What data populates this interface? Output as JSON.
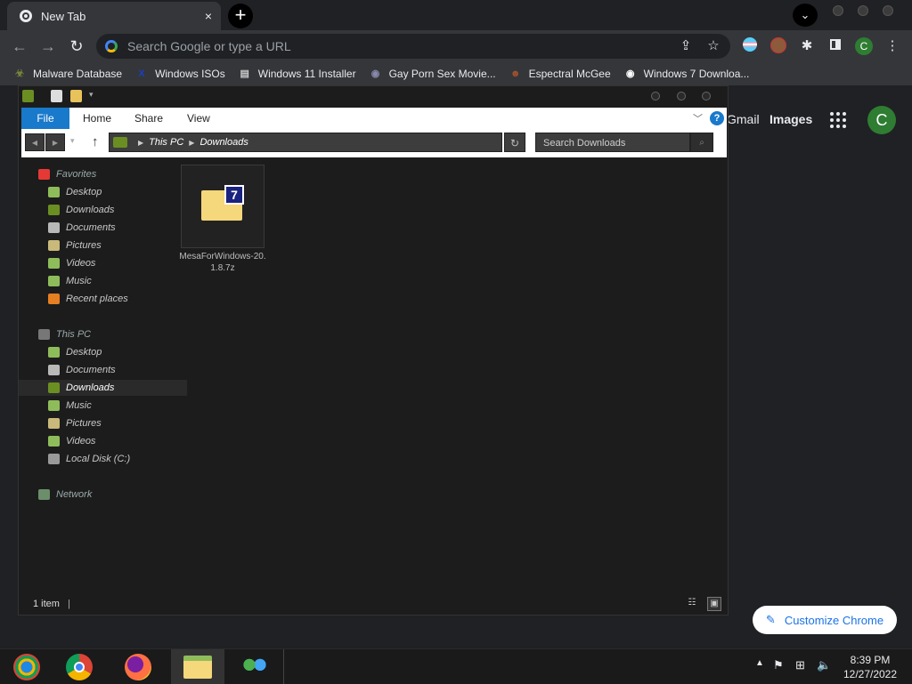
{
  "browser": {
    "tab": {
      "label": "New Tab",
      "close_glyph": "×"
    },
    "new_tab_glyph": "+",
    "tab_search_glyph": "⌄",
    "omnibox": {
      "placeholder": "Search Google or type a URL"
    },
    "profile_initial": "C",
    "bookmarks": [
      {
        "label": "Malware Database",
        "icon": "biohazard-icon",
        "color": "#7b8a3a"
      },
      {
        "label": "Windows ISOs",
        "icon": "x-icon",
        "color": "#1a3fbf"
      },
      {
        "label": "Windows 11 Installer",
        "icon": "page-icon",
        "color": "#cccccc"
      },
      {
        "label": "Gay Porn Sex Movie...",
        "icon": "globe-icon",
        "color": "#8888aa"
      },
      {
        "label": "Espectral McGee",
        "icon": "avatar-icon",
        "color": "#a0522d"
      },
      {
        "label": "Windows 7 Downloa...",
        "icon": "globe-icon",
        "color": "#ffffff"
      }
    ]
  },
  "ntp": {
    "gmail": "Gmail",
    "images": "Images",
    "avatar": "C",
    "customize": "Customize Chrome"
  },
  "explorer": {
    "ribbon": {
      "file": "File",
      "tabs": [
        "Home",
        "Share",
        "View"
      ],
      "help": "?"
    },
    "address": {
      "crumbs": [
        "This PC",
        "Downloads"
      ]
    },
    "search": {
      "placeholder": "Search Downloads"
    },
    "nav": {
      "favorites_label": "Favorites",
      "favorites": [
        {
          "label": "Desktop",
          "color": "#8fbc5a"
        },
        {
          "label": "Downloads",
          "color": "#6b8e23"
        },
        {
          "label": "Documents",
          "color": "#b8b8b8"
        },
        {
          "label": "Pictures",
          "color": "#c9b97a"
        },
        {
          "label": "Videos",
          "color": "#8fbc5a"
        },
        {
          "label": "Music",
          "color": "#8fbc5a"
        },
        {
          "label": "Recent places",
          "color": "#e67e22"
        }
      ],
      "thispc_label": "This PC",
      "thispc": [
        {
          "label": "Desktop",
          "color": "#8fbc5a",
          "selected": false
        },
        {
          "label": "Documents",
          "color": "#b8b8b8",
          "selected": false
        },
        {
          "label": "Downloads",
          "color": "#6b8e23",
          "selected": true
        },
        {
          "label": "Music",
          "color": "#8fbc5a",
          "selected": false
        },
        {
          "label": "Pictures",
          "color": "#c9b97a",
          "selected": false
        },
        {
          "label": "Videos",
          "color": "#8fbc5a",
          "selected": false
        },
        {
          "label": "Local Disk (C:)",
          "color": "#999999",
          "selected": false
        }
      ],
      "network_label": "Network"
    },
    "files": [
      {
        "name": "MesaForWindows-20.1.8.7z",
        "badge": "7"
      }
    ],
    "status": "1 item"
  },
  "taskbar": {
    "clock_time": "8:39 PM",
    "clock_date": "12/27/2022"
  },
  "colors": {
    "accent": "#1979ca",
    "chrome_bg": "#202124",
    "toolbar": "#35363a"
  }
}
